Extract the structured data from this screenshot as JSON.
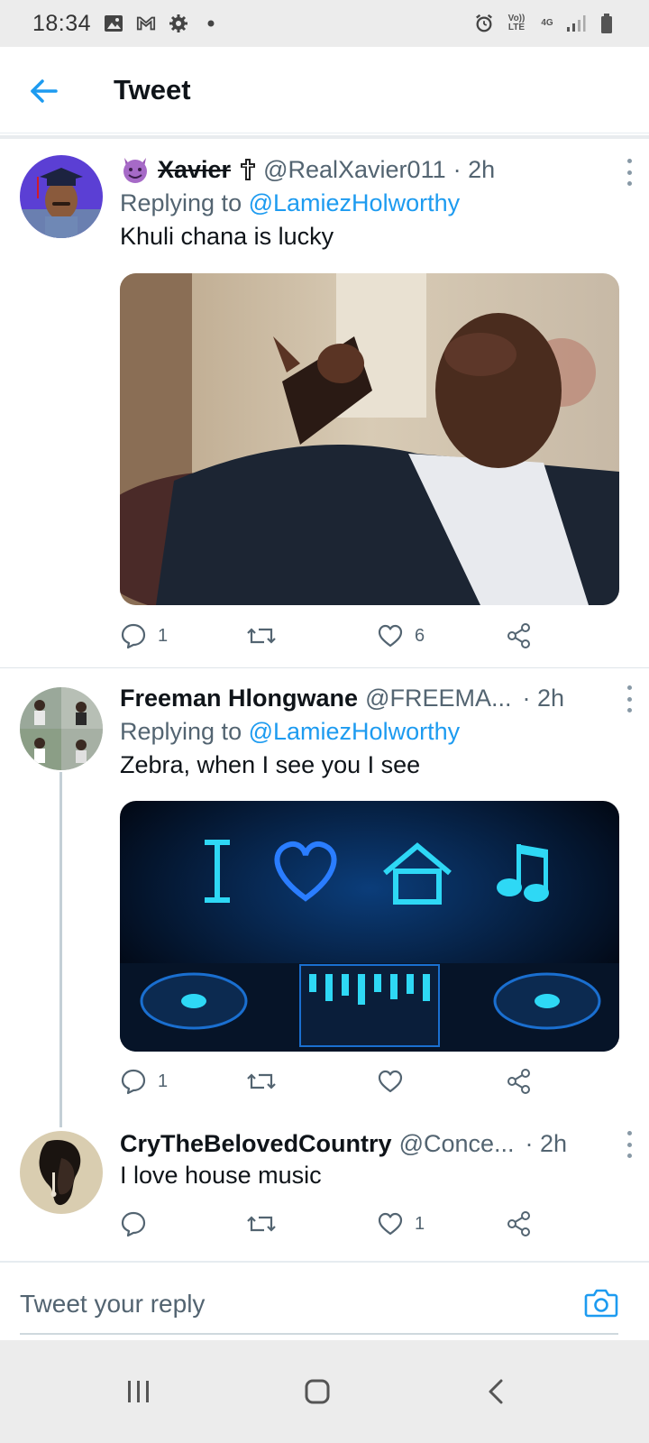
{
  "status_bar": {
    "time": "18:34",
    "left_icons": [
      "image-icon",
      "gmail-icon",
      "settings-icon",
      "dot-icon"
    ],
    "right_icons": [
      "alarm-icon",
      "volte-icon",
      "4g-icon",
      "signal-icon",
      "battery-icon"
    ],
    "volte_label": "Vo)) LTE",
    "network_label": "4G"
  },
  "header": {
    "title": "Tweet",
    "back_icon": "arrow-left-icon",
    "accent_color": "#1d9bf0"
  },
  "tweets": [
    {
      "emoji_icon": "smiling-devil-icon",
      "name": "Xavier",
      "cross_icon": "latin-cross-icon",
      "handle": "@RealXavier011",
      "time": "· 2h",
      "replying_label": "Replying to",
      "replying_to": "@LamiezHolworthy",
      "text": "Khuli chana is lucky",
      "replies": "1",
      "retweets": "",
      "likes": "6"
    },
    {
      "name": "Freeman Hlongwane",
      "handle": "@FREEMA...",
      "time": "· 2h",
      "replying_label": "Replying to",
      "replying_to": "@LamiezHolworthy",
      "text": "Zebra, when I see you I see",
      "replies": "1",
      "retweets": "",
      "likes": ""
    },
    {
      "name": "CryTheBelovedCountry",
      "handle": "@Conce...",
      "time": "· 2h",
      "text": "I love house music",
      "replies": "",
      "retweets": "",
      "likes": "1"
    }
  ],
  "reply_bar": {
    "placeholder": "Tweet your reply",
    "camera_icon": "camera-icon"
  },
  "nav_bar": {
    "buttons": [
      "recent-apps-icon",
      "home-icon",
      "back-icon"
    ]
  }
}
